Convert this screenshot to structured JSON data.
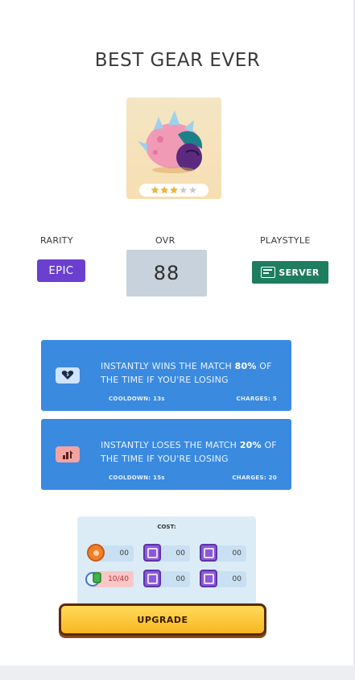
{
  "title": "BEST GEAR EVER",
  "gear": {
    "icon": "spiky-pink-creature-gear-art",
    "stars_filled": 3,
    "stars_total": 5
  },
  "stats": {
    "rarity_label": "RARITY",
    "rarity_value": "EPIC",
    "rarity_color": "#6b3fd0",
    "ovr_label": "OVR",
    "ovr_value": "88",
    "playstyle_label": "PLAYSTYLE",
    "playstyle_value": "SERVER",
    "playstyle_color": "#1e7d5e"
  },
  "abilities": [
    {
      "icon": "heart-icon",
      "icon_bg": "#cfe3ff",
      "text_start": "INSTANTLY WINS THE MATCH ",
      "highlight": "80%",
      "text_end": " OF THE TIME IF YOU'RE LOSING",
      "cooldown": "COOLDOWN: 13s",
      "charges": "CHARGES: 5"
    },
    {
      "icon": "trophy-down-icon",
      "icon_bg": "#f4a3a3",
      "text_start": "INSTANTLY LOSES THE MATCH ",
      "highlight": "20%",
      "text_end": " OF THE TIME IF YOU'RE LOSING",
      "cooldown": "COOLDOWN: 15s",
      "charges": "CHARGES: 20"
    }
  ],
  "cost": {
    "title": "COST:",
    "items": [
      {
        "name": "coins",
        "icon": "coin-icon",
        "value": "00"
      },
      {
        "name": "crate-1",
        "icon": "crate-icon",
        "value": "00"
      },
      {
        "name": "crate-2",
        "icon": "crate-icon",
        "value": "00"
      },
      {
        "name": "shards",
        "icon": "shard-icon",
        "value": "10/40"
      },
      {
        "name": "crate-3",
        "icon": "crate-icon",
        "value": "00"
      },
      {
        "name": "crate-4",
        "icon": "crate-icon",
        "value": "00"
      }
    ]
  },
  "upgrade_label": "UPGRADE"
}
